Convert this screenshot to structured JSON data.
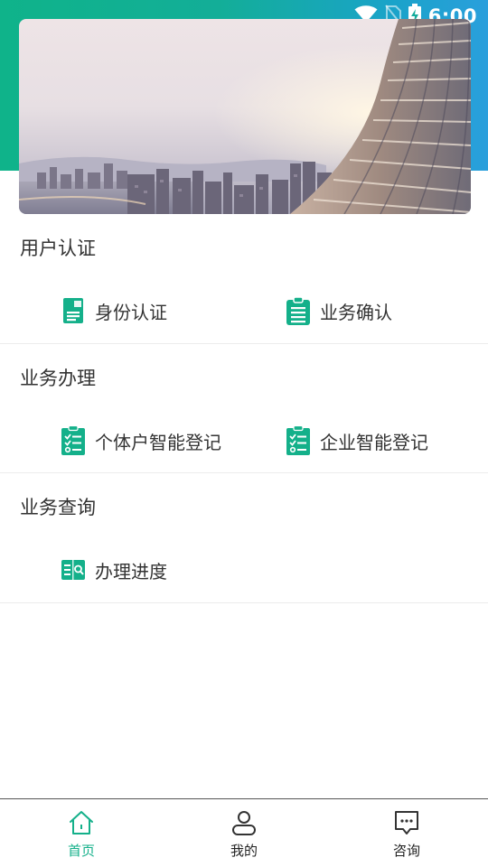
{
  "status_bar": {
    "time": "6:00",
    "icons": [
      "wifi-icon",
      "no-sim-icon",
      "battery-charging-icon"
    ]
  },
  "banner": {
    "image": "city-skyline-banner"
  },
  "sections": [
    {
      "title": "用户认证",
      "items": [
        {
          "label": "身份认证",
          "icon": "id-card-icon"
        },
        {
          "label": "业务确认",
          "icon": "clipboard-list-icon"
        }
      ]
    },
    {
      "title": "业务办理",
      "items": [
        {
          "label": "个体户智能登记",
          "icon": "checklist-icon"
        },
        {
          "label": "企业智能登记",
          "icon": "checklist-icon"
        }
      ]
    },
    {
      "title": "业务查询",
      "items": [
        {
          "label": "办理进度",
          "icon": "progress-search-icon"
        }
      ]
    }
  ],
  "bottom_nav": {
    "items": [
      {
        "label": "首页",
        "icon": "home-icon",
        "active": true
      },
      {
        "label": "我的",
        "icon": "user-icon",
        "active": false
      },
      {
        "label": "咨询",
        "icon": "chat-icon",
        "active": false
      }
    ]
  },
  "colors": {
    "accent": "#14b08a",
    "header_gradient_start": "#0fb38a",
    "header_gradient_end": "#2a9fdc",
    "text": "#333333",
    "divider": "#ececec"
  }
}
